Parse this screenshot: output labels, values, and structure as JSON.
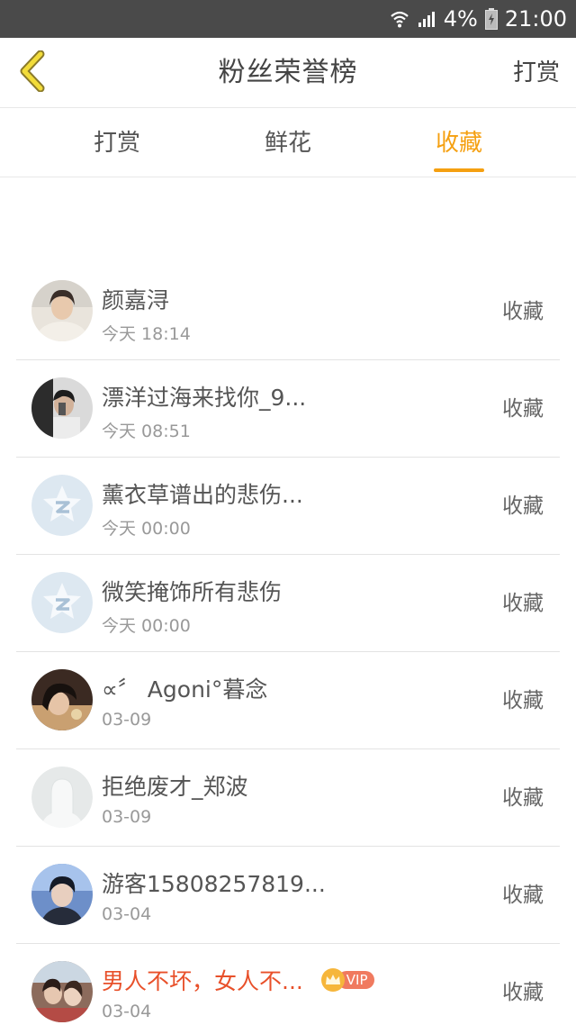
{
  "status_bar": {
    "battery": "4%",
    "time": "21:00"
  },
  "header": {
    "title": "粉丝荣誉榜",
    "right_action": "打赏"
  },
  "tabs": [
    {
      "label": "打赏",
      "active": false
    },
    {
      "label": "鲜花",
      "active": false
    },
    {
      "label": "收藏",
      "active": true
    }
  ],
  "colors": {
    "accent": "#f5a011",
    "vip_name": "#e8502a"
  },
  "fans": [
    {
      "name": "颜嘉浔",
      "time": "今天 18:14",
      "action": "收藏",
      "avatar": "photo"
    },
    {
      "name": "漂洋过海来找你_9...",
      "time": "今天 08:51",
      "action": "收藏",
      "avatar": "photo"
    },
    {
      "name": "薰衣草谱出的悲伤...",
      "time": "今天 00:00",
      "action": "收藏",
      "avatar": "qzone-default-icon"
    },
    {
      "name": "微笑掩饰所有悲伤",
      "time": "今天 00:00",
      "action": "收藏",
      "avatar": "qzone-default-icon"
    },
    {
      "name": "∝〞 Agoni°暮念",
      "time": "03-09",
      "action": "收藏",
      "avatar": "photo"
    },
    {
      "name": "拒绝废才_郑波",
      "time": "03-09",
      "action": "收藏",
      "avatar": "default-silhouette-icon"
    },
    {
      "name": "游客15808257819...",
      "time": "03-04",
      "action": "收藏",
      "avatar": "photo"
    },
    {
      "name": "男人不坏，女人不...",
      "time": "03-04",
      "action": "收藏",
      "avatar": "photo",
      "vip_badge": "VIP"
    }
  ]
}
